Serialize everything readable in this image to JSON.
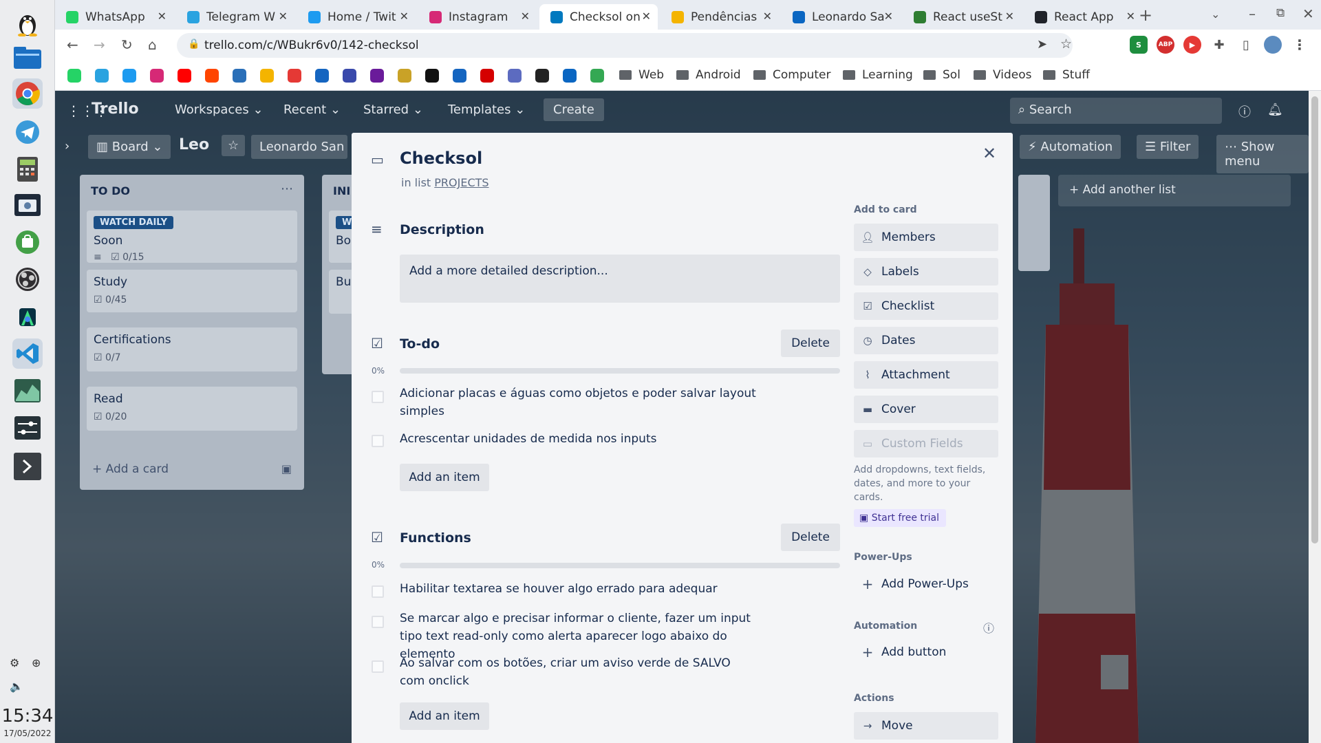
{
  "taskbar": {
    "time": "15:34",
    "date": "17/05/2022"
  },
  "browser": {
    "tabs": [
      {
        "label": "WhatsApp",
        "fav_color": "#25d366",
        "icon": "whatsapp-icon"
      },
      {
        "label": "Telegram W",
        "fav_color": "#2aa3e0",
        "icon": "telegram-icon"
      },
      {
        "label": "Home / Twit",
        "fav_color": "#1d9bf0",
        "icon": "twitter-icon"
      },
      {
        "label": "Instagram",
        "fav_color": "#d62976",
        "icon": "instagram-icon"
      },
      {
        "label": "Checksol on",
        "fav_color": "#0079bf",
        "icon": "trello-icon"
      },
      {
        "label": "Pendências",
        "fav_color": "#f4b400",
        "icon": "notes-icon"
      },
      {
        "label": "Leonardo Sa",
        "fav_color": "#0a66c2",
        "icon": "linkedin-icon"
      },
      {
        "label": "React useSt",
        "fav_color": "#2e7d32",
        "icon": "wiki-icon"
      },
      {
        "label": "React App",
        "fav_color": "#20232a",
        "icon": "react-icon"
      }
    ],
    "active_tab_index": 4,
    "new_tab_symbol": "+",
    "url": "trello.com/c/WBukr6v0/142-checksol",
    "bookmark_folders": [
      "Web",
      "Android",
      "Computer",
      "Learning",
      "Sol",
      "Videos",
      "Stuff"
    ],
    "bookmark_icon_colors": [
      "#25d366",
      "#2aa3e0",
      "#1d9bf0",
      "#d62976",
      "#ff0000",
      "#ff4500",
      "#2a6fb8",
      "#f4b400",
      "#e53935",
      "#1565c0",
      "#3949ab",
      "#6a1b9a",
      "#c9a227",
      "#111111",
      "#1565c0",
      "#d50000",
      "#5c6bc0",
      "#222222",
      "#0a66c2",
      "#34a853"
    ]
  },
  "trello": {
    "logo": "Trello",
    "nav": [
      "Workspaces",
      "Recent",
      "Starred",
      "Templates"
    ],
    "create_label": "Create",
    "search_placeholder": "Search",
    "board_view": "Board",
    "board_name": "Leo",
    "workspace_name": "Leonardo San",
    "automation_label": "Automation",
    "filter_label": "Filter",
    "show_menu_label": "Show menu",
    "add_another_list": "Add another list",
    "lists": [
      {
        "title": "TO DO",
        "cards": [
          {
            "label": "WATCH DAILY",
            "title": "Soon",
            "checklist": "0/15",
            "has_description": true
          },
          {
            "title": "Study",
            "checklist": "0/45"
          },
          {
            "title": "Certifications",
            "checklist": "0/7"
          },
          {
            "title": "Read",
            "checklist": "0/20"
          }
        ],
        "add_card": "Add a card"
      },
      {
        "title": "INI",
        "cards": [
          {
            "label": "W",
            "title": "Boo",
            "checklist": ""
          },
          {
            "title": "Buy",
            "checklist": ""
          }
        ]
      }
    ]
  },
  "modal": {
    "title": "Checksol",
    "in_list_prefix": "in list",
    "list_name": "PROJECTS",
    "description_title": "Description",
    "description_placeholder": "Add a more detailed description...",
    "checklists": [
      {
        "title": "To-do",
        "delete_label": "Delete",
        "progress": 0,
        "progress_label": "0%",
        "items": [
          "Adicionar placas e águas como objetos e poder salvar layout simples",
          "Acrescentar unidades de medida nos inputs"
        ],
        "add_item_label": "Add an item"
      },
      {
        "title": "Functions",
        "delete_label": "Delete",
        "progress": 0,
        "progress_label": "0%",
        "items": [
          "Habilitar textarea se houver algo errado para adequar",
          "Se marcar algo e precisar informar o cliente, fazer um input tipo text read-only como alerta aparecer logo abaixo do elemento",
          "Ao salvar com os botões, criar um aviso verde de SALVO com onclick"
        ],
        "add_item_label": "Add an item"
      }
    ],
    "sidebar": {
      "add_to_card_heading": "Add to card",
      "add_to_card": [
        "Members",
        "Labels",
        "Checklist",
        "Dates",
        "Attachment",
        "Cover",
        "Custom Fields"
      ],
      "custom_fields_note": "Add dropdowns, text fields, dates, and more to your cards.",
      "start_trial": "Start free trial",
      "powerups_heading": "Power-Ups",
      "add_powerups": "Add Power-Ups",
      "automation_heading": "Automation",
      "add_button": "Add button",
      "actions_heading": "Actions",
      "move": "Move"
    }
  }
}
